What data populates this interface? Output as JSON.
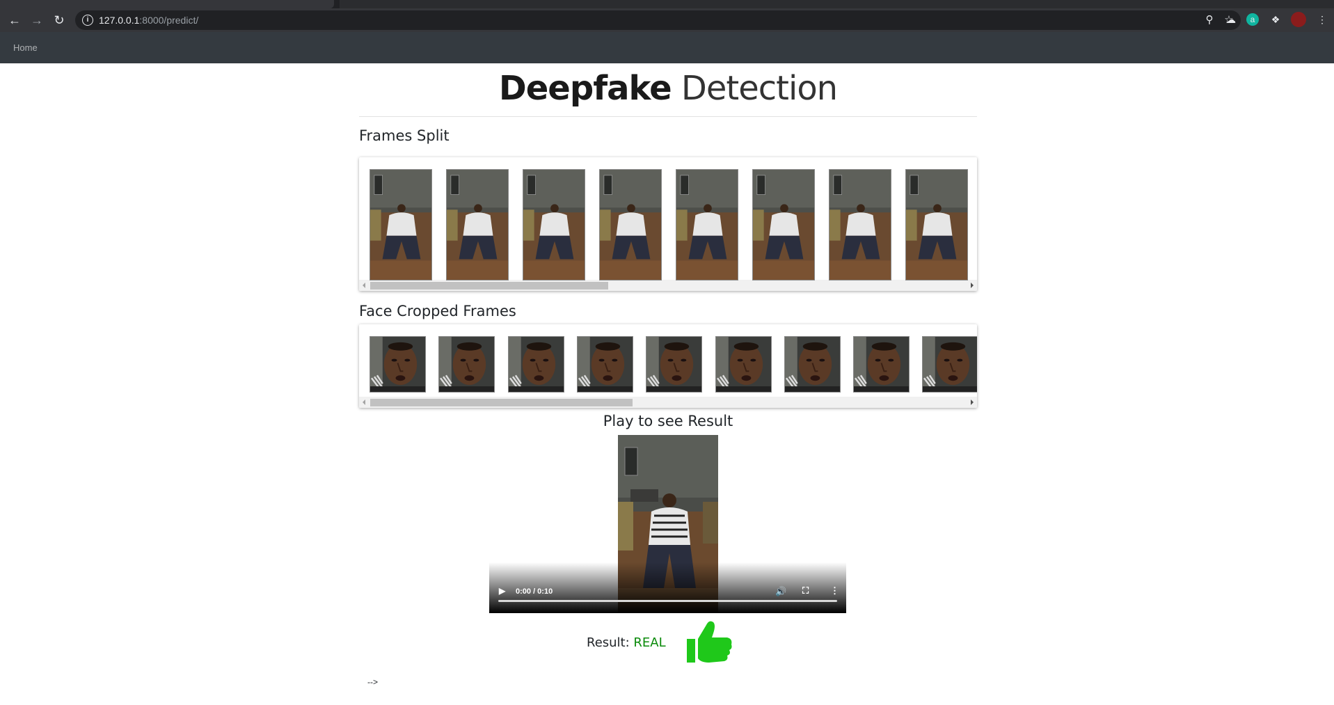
{
  "browser": {
    "url_host": "127.0.0.1",
    "url_rest": ":8000/predict/"
  },
  "navbar": {
    "home_label": "Home"
  },
  "page": {
    "title_bold": "Deepfake",
    "title_light": "Detection",
    "frames_split_heading": "Frames Split",
    "face_cropped_heading": "Face Cropped Frames",
    "play_heading": "Play to see Result",
    "result_label": "Result:",
    "result_value": "REAL",
    "trailing_text": "-->"
  },
  "video": {
    "time": "0:00 / 0:10"
  },
  "colors": {
    "result_real": "#0a8a0a",
    "thumbs_up": "#22cc11",
    "navbar": "#343a40"
  },
  "frames_split_count": 8,
  "face_frames_count": 9
}
